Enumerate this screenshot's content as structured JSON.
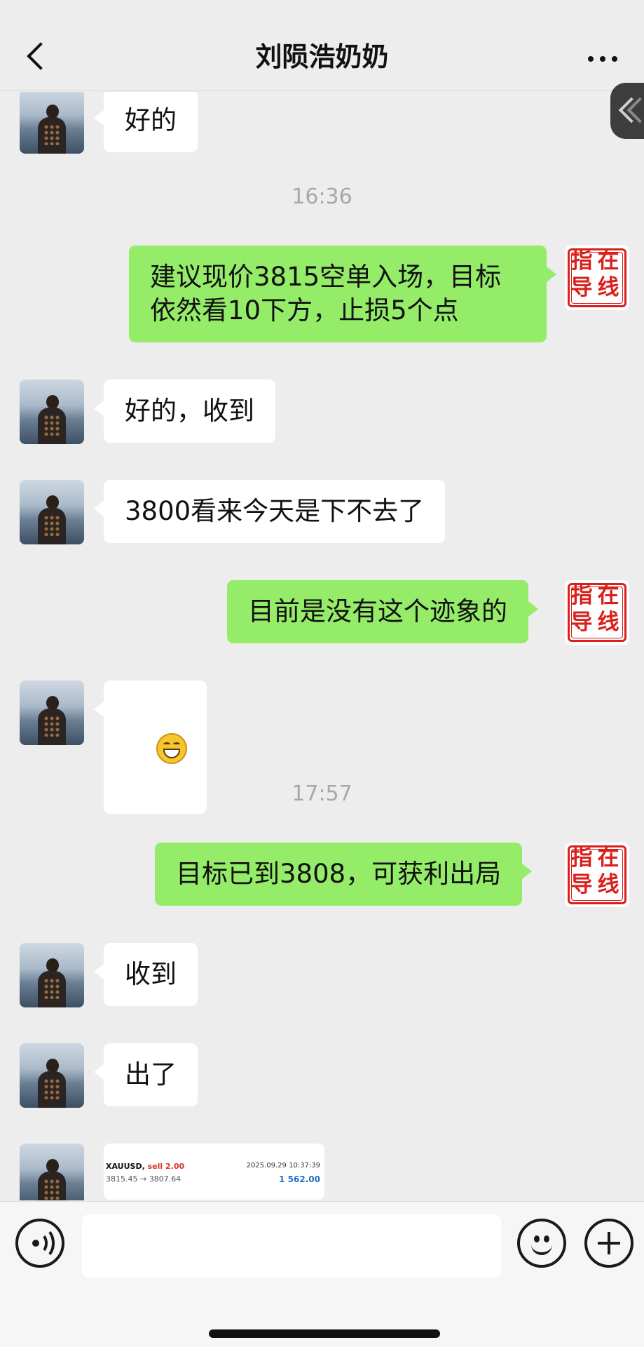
{
  "header": {
    "title": "刘陨浩奶奶"
  },
  "stamp": {
    "chars": [
      "指",
      "在",
      "导",
      "线"
    ]
  },
  "messages": [
    {
      "type": "in",
      "text": "好的"
    },
    {
      "type": "time",
      "text": "16:36"
    },
    {
      "type": "out",
      "text": "建议现价3815空单入场，目标依然看10下方，止损5个点"
    },
    {
      "type": "in",
      "text": "好的，收到"
    },
    {
      "type": "in",
      "text": "3800看来今天是下不去了"
    },
    {
      "type": "out",
      "text": "目前是没有这个迹象的"
    },
    {
      "type": "in",
      "emoji": "grinning-face"
    },
    {
      "type": "time",
      "text": "17:57"
    },
    {
      "type": "out",
      "text": "目标已到3808，可获利出局"
    },
    {
      "type": "in",
      "text": "收到"
    },
    {
      "type": "in",
      "text": "出了"
    }
  ],
  "trade_card": {
    "symbol": "XAUUSD,",
    "side": "sell 2.00",
    "datetime": "2025.09.29 10:37:39",
    "prices": "3815.45 → 3807.64",
    "profit": "1 562.00"
  },
  "input": {
    "value": ""
  },
  "icons": {
    "back": "chevron-left-icon",
    "more": "more-dots-icon",
    "voice": "voice-icon",
    "emoji": "emoji-face-icon",
    "plus": "plus-icon"
  },
  "colors": {
    "background": "#ededed",
    "outgoing_bubble": "#95ec69",
    "incoming_bubble": "#ffffff",
    "stamp_red": "#d9201c"
  }
}
